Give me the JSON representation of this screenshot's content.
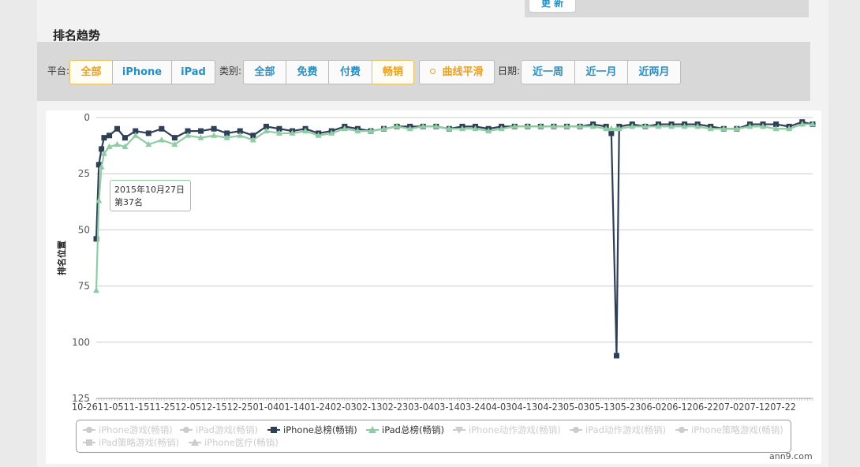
{
  "page": {
    "update_button": "更 新",
    "section_title": "排名趋势"
  },
  "filters": {
    "platform_label": "平台:",
    "platform_options": [
      "全部",
      "iPhone",
      "iPad"
    ],
    "platform_selected": "全部",
    "category_label": "类别:",
    "category_options": [
      "全部",
      "免费",
      "付费",
      "畅销"
    ],
    "category_selected": "畅销",
    "smooth_label": "曲线平滑",
    "date_label": "日期:",
    "date_options": [
      "近一周",
      "近一月",
      "近两月"
    ]
  },
  "colors": {
    "iphone_series": "#2e4057",
    "ipad_series": "#8fcca4",
    "active_button": "#e8a020",
    "link_blue": "#2a8fc0"
  },
  "tooltip": {
    "date": "2015年10月27日",
    "rank": "第37名"
  },
  "watermark": "ann9.com",
  "chart_data": {
    "type": "line",
    "ylabel": "排名位置",
    "ylim": [
      0,
      125
    ],
    "y_reversed": true,
    "yticks": [
      0,
      25,
      50,
      75,
      100,
      125
    ],
    "grid": true,
    "x_tick_labels": [
      "10-26",
      "11-05",
      "11-15",
      "11-25",
      "12-05",
      "12-15",
      "12-25",
      "01-04",
      "01-14",
      "01-24",
      "02-03",
      "02-13",
      "02-23",
      "03-04",
      "03-14",
      "03-24",
      "04-03",
      "04-13",
      "04-23",
      "05-03",
      "05-13",
      "05-23",
      "06-02",
      "06-12",
      "06-22",
      "07-02",
      "07-12",
      "07-22"
    ],
    "x_start": "10-26",
    "x_end": "07-26",
    "series": [
      {
        "name": "iPhone总榜(畅销)",
        "marker": "square",
        "color": "#2e4057",
        "points": [
          [
            "10-26",
            54
          ],
          [
            "10-27",
            21
          ],
          [
            "10-28",
            14
          ],
          [
            "10-29",
            9
          ],
          [
            "10-31",
            8
          ],
          [
            "11-03",
            5
          ],
          [
            "11-06",
            9
          ],
          [
            "11-10",
            6
          ],
          [
            "11-15",
            7
          ],
          [
            "11-20",
            5
          ],
          [
            "11-25",
            9
          ],
          [
            "11-30",
            6
          ],
          [
            "12-05",
            6
          ],
          [
            "12-10",
            5
          ],
          [
            "12-15",
            7
          ],
          [
            "12-20",
            6
          ],
          [
            "12-25",
            8
          ],
          [
            "12-30",
            4
          ],
          [
            "01-04",
            5
          ],
          [
            "01-09",
            6
          ],
          [
            "01-14",
            5
          ],
          [
            "01-19",
            7
          ],
          [
            "01-24",
            6
          ],
          [
            "01-29",
            4
          ],
          [
            "02-03",
            5
          ],
          [
            "02-08",
            6
          ],
          [
            "02-13",
            5
          ],
          [
            "02-18",
            4
          ],
          [
            "02-23",
            4
          ],
          [
            "02-28",
            4
          ],
          [
            "03-04",
            4
          ],
          [
            "03-09",
            5
          ],
          [
            "03-14",
            4
          ],
          [
            "03-19",
            4
          ],
          [
            "03-24",
            5
          ],
          [
            "03-29",
            4
          ],
          [
            "04-03",
            4
          ],
          [
            "04-08",
            4
          ],
          [
            "04-13",
            4
          ],
          [
            "04-18",
            4
          ],
          [
            "04-23",
            4
          ],
          [
            "04-28",
            4
          ],
          [
            "05-03",
            3
          ],
          [
            "05-08",
            4
          ],
          [
            "05-10",
            7
          ],
          [
            "05-12",
            106
          ],
          [
            "05-13",
            4
          ],
          [
            "05-18",
            3
          ],
          [
            "05-23",
            4
          ],
          [
            "05-28",
            3
          ],
          [
            "06-02",
            3
          ],
          [
            "06-07",
            3
          ],
          [
            "06-12",
            3
          ],
          [
            "06-17",
            4
          ],
          [
            "06-22",
            5
          ],
          [
            "06-27",
            5
          ],
          [
            "07-02",
            3
          ],
          [
            "07-07",
            3
          ],
          [
            "07-12",
            3
          ],
          [
            "07-17",
            4
          ],
          [
            "07-22",
            2
          ],
          [
            "07-26",
            3
          ]
        ]
      },
      {
        "name": "iPad总榜(畅销)",
        "marker": "triangle",
        "color": "#8fcca4",
        "points": [
          [
            "10-26",
            77
          ],
          [
            "10-27",
            37
          ],
          [
            "10-28",
            22
          ],
          [
            "10-29",
            16
          ],
          [
            "10-31",
            13
          ],
          [
            "11-03",
            12
          ],
          [
            "11-06",
            13
          ],
          [
            "11-10",
            8
          ],
          [
            "11-15",
            12
          ],
          [
            "11-20",
            10
          ],
          [
            "11-25",
            12
          ],
          [
            "11-30",
            8
          ],
          [
            "12-05",
            9
          ],
          [
            "12-10",
            8
          ],
          [
            "12-15",
            9
          ],
          [
            "12-20",
            8
          ],
          [
            "12-25",
            10
          ],
          [
            "12-30",
            6
          ],
          [
            "01-04",
            7
          ],
          [
            "01-09",
            7
          ],
          [
            "01-14",
            6
          ],
          [
            "01-19",
            8
          ],
          [
            "01-24",
            7
          ],
          [
            "01-29",
            5
          ],
          [
            "02-03",
            6
          ],
          [
            "02-08",
            6
          ],
          [
            "02-13",
            5
          ],
          [
            "02-18",
            4
          ],
          [
            "02-23",
            5
          ],
          [
            "02-28",
            4
          ],
          [
            "03-04",
            4
          ],
          [
            "03-09",
            5
          ],
          [
            "03-14",
            5
          ],
          [
            "03-19",
            5
          ],
          [
            "03-24",
            6
          ],
          [
            "03-29",
            5
          ],
          [
            "04-03",
            4
          ],
          [
            "04-08",
            4
          ],
          [
            "04-13",
            4
          ],
          [
            "04-18",
            4
          ],
          [
            "04-23",
            4
          ],
          [
            "04-28",
            4
          ],
          [
            "05-03",
            4
          ],
          [
            "05-08",
            5
          ],
          [
            "05-10",
            5
          ],
          [
            "05-12",
            5
          ],
          [
            "05-13",
            5
          ],
          [
            "05-18",
            4
          ],
          [
            "05-23",
            4
          ],
          [
            "05-28",
            4
          ],
          [
            "06-02",
            4
          ],
          [
            "06-07",
            4
          ],
          [
            "06-12",
            4
          ],
          [
            "06-17",
            5
          ],
          [
            "06-22",
            5
          ],
          [
            "06-27",
            5
          ],
          [
            "07-02",
            4
          ],
          [
            "07-07",
            4
          ],
          [
            "07-12",
            5
          ],
          [
            "07-17",
            5
          ],
          [
            "07-22",
            3
          ],
          [
            "07-26",
            3
          ]
        ]
      }
    ],
    "legend_position": "bottom",
    "legend": [
      {
        "name": "iPhone游戏(畅销)",
        "enabled": false,
        "marker": "circle"
      },
      {
        "name": "iPad游戏(畅销)",
        "enabled": false,
        "marker": "circle"
      },
      {
        "name": "iPhone总榜(畅销)",
        "enabled": true,
        "marker": "square"
      },
      {
        "name": "iPad总榜(畅销)",
        "enabled": true,
        "marker": "triangle"
      },
      {
        "name": "iPhone动作游戏(畅销)",
        "enabled": false,
        "marker": "triangle-down"
      },
      {
        "name": "iPad动作游戏(畅销)",
        "enabled": false,
        "marker": "circle"
      },
      {
        "name": "iPhone策略游戏(畅销)",
        "enabled": false,
        "marker": "circle"
      },
      {
        "name": "iPad策略游戏(畅销)",
        "enabled": false,
        "marker": "square"
      },
      {
        "name": "iPhone医疗(畅销)",
        "enabled": false,
        "marker": "triangle"
      }
    ]
  }
}
